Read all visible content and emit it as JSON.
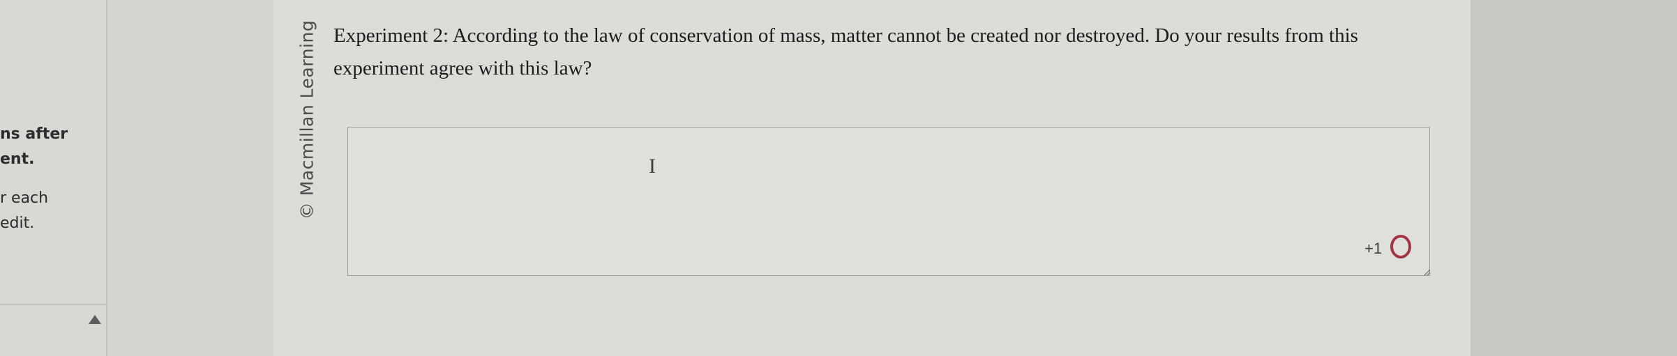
{
  "left_panel": {
    "lines": [
      "ns after",
      "ent.",
      "r each",
      "edit."
    ]
  },
  "watermark": {
    "text": "© Macmillan Learning"
  },
  "question": {
    "text": "Experiment 2: According to the law of conservation of mass, matter cannot be created nor destroyed. Do your results from this experiment agree with this law?"
  },
  "answer": {
    "value": "",
    "points_label": "+1",
    "status_color": "#a33347"
  },
  "icons": {
    "text_cursor": "i-beam-cursor-icon",
    "status": "status-circle-icon",
    "resize": "resize-handle-icon",
    "scroll_up": "triangle-up-icon"
  }
}
